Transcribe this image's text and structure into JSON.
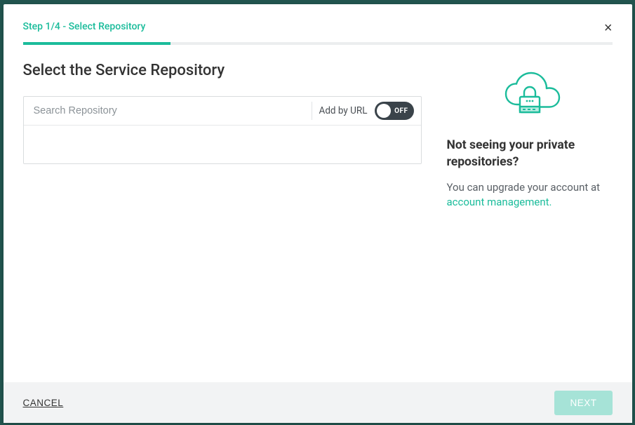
{
  "step": {
    "label": "Step 1/4 - Select Repository",
    "progress_percent": 25
  },
  "heading": "Select the Service Repository",
  "search": {
    "placeholder": "Search Repository",
    "value": "",
    "add_by_url_label": "Add by URL",
    "toggle_state": "off",
    "toggle_text": "OFF"
  },
  "info_panel": {
    "heading": "Not seeing your private repositories?",
    "body_prefix": "You can upgrade your account at ",
    "link_text": "account management.",
    "link_href": "#"
  },
  "footer": {
    "cancel_label": "CANCEL",
    "next_label": "NEXT"
  },
  "close_icon": "×"
}
